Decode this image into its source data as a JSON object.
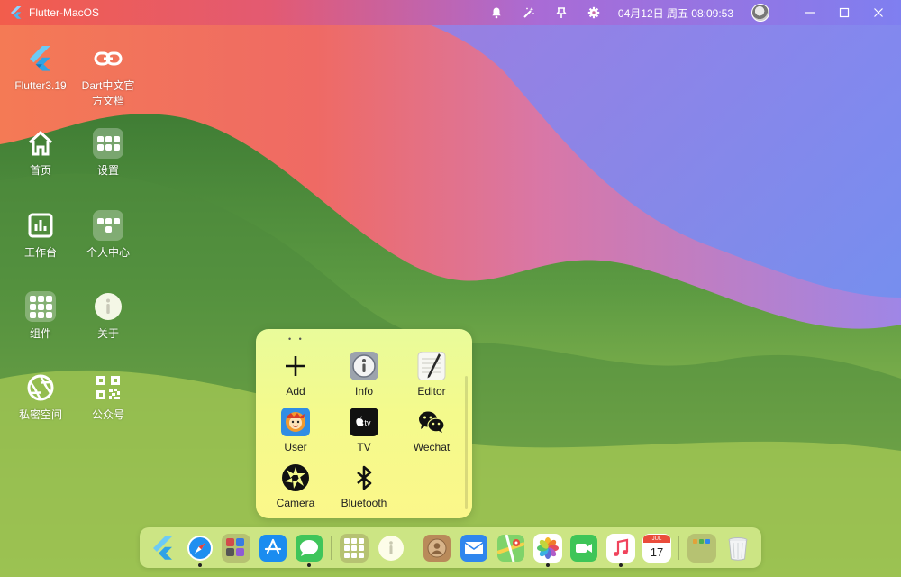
{
  "titlebar": {
    "app_title": "Flutter-MacOS",
    "datetime": "04月12日 周五 08:09:53",
    "icons": [
      "bell-icon",
      "magic-wand-icon",
      "pin-icon",
      "gear-icon"
    ],
    "window_controls": [
      "minimize-icon",
      "maximize-icon",
      "close-icon"
    ]
  },
  "desktop": {
    "items": [
      {
        "label": "Flutter3.19",
        "icon": "flutter-logo-icon"
      },
      {
        "label": "Dart中文官方文档",
        "icon": "link-icon"
      },
      {
        "label": "首页",
        "icon": "home-icon"
      },
      {
        "label": "设置",
        "icon": "settings-folder-icon"
      },
      {
        "label": "工作台",
        "icon": "chart-board-icon"
      },
      {
        "label": "个人中心",
        "icon": "profile-folder-icon"
      },
      {
        "label": "组件",
        "icon": "components-folder-icon"
      },
      {
        "label": "关于",
        "icon": "info-icon"
      },
      {
        "label": "私密空间",
        "icon": "aperture-icon"
      },
      {
        "label": "公众号",
        "icon": "qr-code-icon"
      }
    ]
  },
  "panel": {
    "items": [
      {
        "label": "Add",
        "icon": "plus-icon"
      },
      {
        "label": "Info",
        "icon": "info-icon"
      },
      {
        "label": "Editor",
        "icon": "editor-icon"
      },
      {
        "label": "User",
        "icon": "user-icon"
      },
      {
        "label": "TV",
        "icon": "apple-tv-icon"
      },
      {
        "label": "Wechat",
        "icon": "wechat-icon"
      },
      {
        "label": "Camera",
        "icon": "camera-aperture-icon"
      },
      {
        "label": "Bluetooth",
        "icon": "bluetooth-icon"
      }
    ]
  },
  "dock": {
    "items": [
      {
        "name": "flutter",
        "icon": "flutter-logo-icon",
        "running": false
      },
      {
        "name": "safari",
        "icon": "compass-icon",
        "running": true
      },
      {
        "name": "apps-folder",
        "icon": "apps-folder-icon",
        "running": false
      },
      {
        "name": "app-store",
        "icon": "app-store-icon",
        "running": false
      },
      {
        "name": "messages",
        "icon": "message-bubble-icon",
        "running": true
      },
      {
        "name": "tools-folder",
        "icon": "tools-folder-icon",
        "running": false
      },
      {
        "name": "info",
        "icon": "info-icon",
        "running": false
      },
      {
        "name": "contacts",
        "icon": "contacts-icon",
        "running": false
      },
      {
        "name": "mail",
        "icon": "mail-icon",
        "running": false
      },
      {
        "name": "maps",
        "icon": "maps-icon",
        "running": false
      },
      {
        "name": "photos",
        "icon": "photos-icon",
        "running": true
      },
      {
        "name": "facetime",
        "icon": "video-camera-icon",
        "running": false
      },
      {
        "name": "music",
        "icon": "music-icon",
        "running": true
      },
      {
        "name": "calendar",
        "icon": "calendar-icon",
        "running": false,
        "month": "JUL",
        "day": "17"
      },
      {
        "name": "downloads-folder",
        "icon": "folder-icon",
        "running": false
      },
      {
        "name": "trash",
        "icon": "trash-icon",
        "running": false
      }
    ]
  }
}
